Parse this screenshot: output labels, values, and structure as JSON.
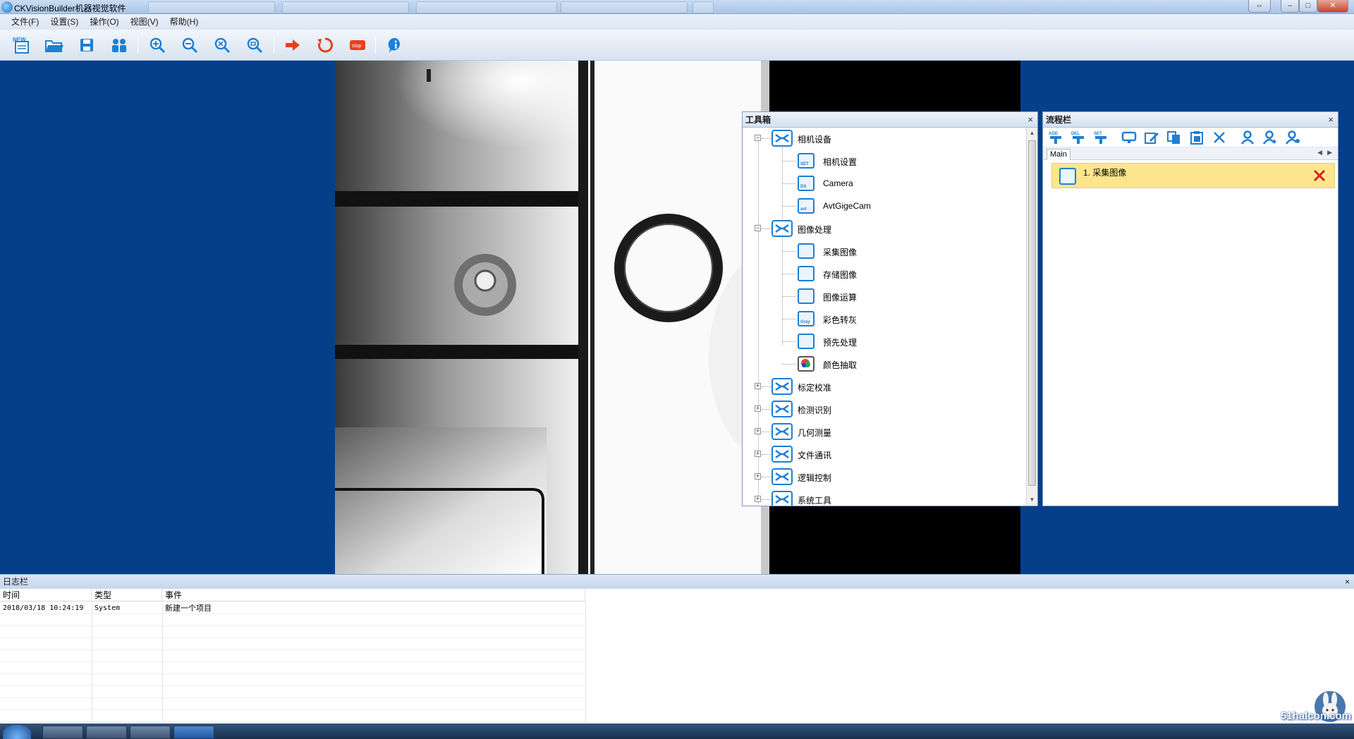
{
  "window": {
    "title": "CKVisionBuilder机器视觉软件"
  },
  "menu": {
    "items": [
      "文件(F)",
      "设置(S)",
      "操作(O)",
      "视图(V)",
      "帮助(H)"
    ]
  },
  "toolbar": {
    "buttons": [
      {
        "name": "new",
        "icon": "new-file-icon",
        "text": "NEW"
      },
      {
        "name": "open",
        "icon": "open-folder-icon"
      },
      {
        "name": "save",
        "icon": "save-disk-icon"
      },
      {
        "name": "users",
        "icon": "users-icon"
      },
      {
        "name": "zoom-in",
        "icon": "zoom-in-icon"
      },
      {
        "name": "zoom-out",
        "icon": "zoom-out-icon"
      },
      {
        "name": "zoom-fit",
        "icon": "zoom-fit-icon"
      },
      {
        "name": "zoom-actual",
        "icon": "zoom-actual-icon"
      },
      {
        "name": "run-once",
        "icon": "run-arrow-icon"
      },
      {
        "name": "run-loop",
        "icon": "loop-icon"
      },
      {
        "name": "stop",
        "icon": "stop-icon",
        "text": "stop"
      },
      {
        "name": "about",
        "icon": "info-icon"
      }
    ],
    "accent_colors": {
      "blue": "#1d7fd4",
      "red": "#e8401c"
    }
  },
  "toolbox": {
    "title": "工具箱",
    "close": "×",
    "categories": [
      {
        "label": "相机设备",
        "expanded": true,
        "children": [
          {
            "label": "相机设置",
            "badge": "SET"
          },
          {
            "label": "Camera",
            "badge": "DS"
          },
          {
            "label": "AvtGigeCam",
            "badge": "avt"
          }
        ]
      },
      {
        "label": "图像处理",
        "expanded": true,
        "children": [
          {
            "label": "采集图像",
            "badge": ""
          },
          {
            "label": "存储图像",
            "badge": ""
          },
          {
            "label": "图像运算",
            "badge": ""
          },
          {
            "label": "彩色转灰",
            "badge": "Gray"
          },
          {
            "label": "预先处理",
            "badge": ""
          },
          {
            "label": "颜色抽取",
            "badge": ""
          }
        ]
      },
      {
        "label": "标定校准",
        "expanded": false,
        "children": []
      },
      {
        "label": "检测识别",
        "expanded": false,
        "children": []
      },
      {
        "label": "几何测量",
        "expanded": false,
        "children": []
      },
      {
        "label": "文件通讯",
        "expanded": false,
        "children": []
      },
      {
        "label": "逻辑控制",
        "expanded": false,
        "children": []
      },
      {
        "label": "系统工具",
        "expanded": false,
        "children": []
      }
    ]
  },
  "flowbar": {
    "title": "流程栏",
    "close": "×",
    "tools": [
      {
        "icon": "add-step-icon",
        "text": "ADD"
      },
      {
        "icon": "delete-step-icon",
        "text": "DEL"
      },
      {
        "icon": "set-step-icon",
        "text": "SET"
      },
      {
        "icon": "monitor-icon"
      },
      {
        "icon": "edit-icon"
      },
      {
        "icon": "copy-icon"
      },
      {
        "icon": "paste-icon"
      },
      {
        "icon": "cut-icon"
      },
      {
        "icon": "user-icon"
      },
      {
        "icon": "user-up-icon"
      },
      {
        "icon": "user-search-icon"
      }
    ],
    "tab": "Main",
    "items": [
      {
        "label": "1. 采集图像"
      }
    ]
  },
  "log": {
    "title": "日志栏",
    "close": "×",
    "columns": [
      "时间",
      "类型",
      "事件"
    ],
    "rows": [
      {
        "time": "2018/03/18 10:24:19",
        "type": "System",
        "event": "新建一个项目"
      }
    ]
  },
  "watermark": {
    "text": "51halcon.com"
  }
}
